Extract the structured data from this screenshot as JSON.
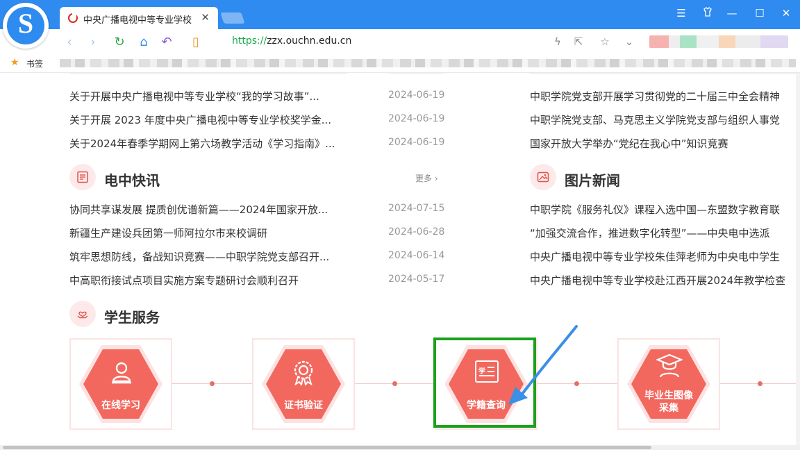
{
  "browser": {
    "tab_title": "中央广播电视中等专业学校",
    "tab_close": "✕",
    "url_protocol": "https://",
    "url_host": "zzx.ouchn.edu.cn",
    "bookmarks_label": "书签"
  },
  "notices": [
    {
      "title": "关于开展中央广播电视中等专业学校“我的学习故事”...",
      "date": "2024-06-19"
    },
    {
      "title": "关于开展 2023 年度中央广播电视中等专业学校奖学金...",
      "date": "2024-06-19"
    },
    {
      "title": "关于2024年春季学期网上第六场教学活动《学习指南》...",
      "date": "2024-06-19"
    }
  ],
  "right_top_news": [
    "中职学院党支部开展学习贯彻党的二十届三中全会精神",
    "中职学院党支部、马克思主义学院党支部与组织人事党",
    "国家开放大学举办“党纪在我心中”知识竞赛"
  ],
  "quick_news": {
    "title": "电中快讯",
    "more": "更多",
    "items": [
      {
        "title": "协同共享谋发展 提质创优谱新篇——2024年国家开放...",
        "date": "2024-07-15"
      },
      {
        "title": "新疆生产建设兵团第一师阿拉尔市来校调研",
        "date": "2024-06-28"
      },
      {
        "title": "筑牢思想防线，备战知识竞赛——中职学院党支部召开...",
        "date": "2024-06-14"
      },
      {
        "title": "中高职衔接试点项目实施方案专题研讨会顺利召开",
        "date": "2024-05-17"
      }
    ]
  },
  "photo_news": {
    "title": "图片新闻",
    "items": [
      "中职学院《服务礼仪》课程入选中国—东盟数字教育联",
      "“加强交流合作，推进数字化转型”——中央电中选派",
      "中央广播电视中等专业学校朱佳萍老师为中央电中学生",
      "中央广播电视中等专业学校赴江西开展2024年教学检查"
    ]
  },
  "student_services": {
    "title": "学生服务",
    "items": [
      {
        "label": "在线学习",
        "icon": "person-icon"
      },
      {
        "label": "证书验证",
        "icon": "certificate-icon"
      },
      {
        "label": "学籍查询",
        "icon": "student-record-icon",
        "icon_text": "学"
      },
      {
        "label": "毕业生图像\n采集",
        "icon": "graduate-icon"
      }
    ]
  },
  "colors": {
    "accent": "#f2685e",
    "chrome_blue": "#2f8bf0",
    "highlight": "#1da11d",
    "arrow": "#3a8fe6"
  }
}
